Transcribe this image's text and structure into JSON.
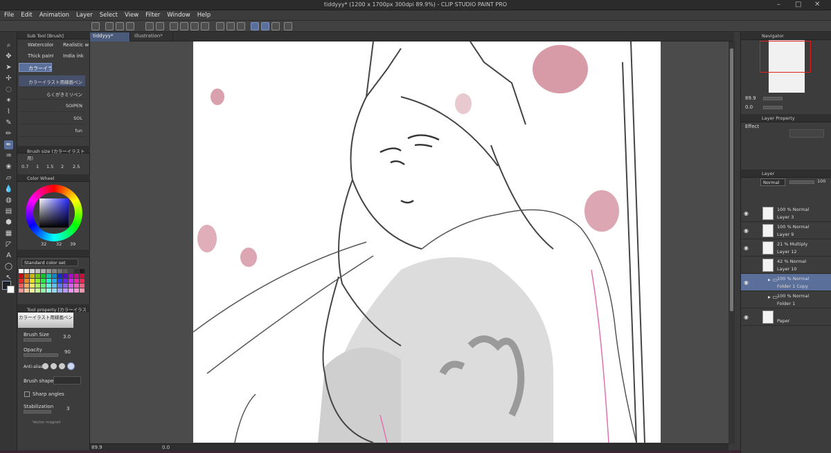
{
  "window": {
    "title": "tiddyyy* (1200 x 1700px 300dpi 89.9%) - CLIP STUDIO PAINT PRO"
  },
  "menu": [
    "File",
    "Edit",
    "Animation",
    "Layer",
    "Select",
    "View",
    "Filter",
    "Window",
    "Help"
  ],
  "tabs": [
    {
      "label": "tiddyyy*"
    },
    {
      "label": "Illustration*"
    }
  ],
  "subtool": {
    "header": "Sub Tool [Brush]",
    "groups": [
      "Watercolor",
      "Realistic w",
      "Thick paint",
      "India ink",
      "カラーイラ"
    ],
    "brushes": [
      "カラーイラスト用線画ペン",
      "らくがきミリペン",
      "SOIPEN",
      "SOL",
      "fun"
    ]
  },
  "brushsize": {
    "header": "Brush size (カラーイラスト用)",
    "values": [
      "0.7",
      "1",
      "1.5",
      "2",
      "2.5"
    ]
  },
  "colorwheel": {
    "header": "Color Wheel",
    "r": "32",
    "g": "32",
    "b": "39",
    "main_color": "#202027"
  },
  "colorset": {
    "selected": "Standard color set"
  },
  "toolprop": {
    "header": "Tool property [カラーイラスト用]",
    "name": "カラーイラスト用線画ペン",
    "brush_size_label": "Brush Size",
    "brush_size": "3.0",
    "opacity_label": "Opacity",
    "opacity": "90",
    "antialias_label": "Anti-alias",
    "brush_shape_label": "Brush shape",
    "sharp_angles": "Sharp angles",
    "stabilization_label": "Stabilization",
    "stabilization": "3",
    "vector_magnet": "Vector magnet"
  },
  "navigator": {
    "header": "Navigator",
    "zoom": "89.9",
    "rotation": "0.0"
  },
  "layerprop": {
    "header": "Layer Property",
    "effect_label": "Effect"
  },
  "layers": {
    "header": "Layer",
    "blend": "Normal",
    "opacity": "100",
    "items": [
      {
        "mode": "100 % Normal",
        "name": "Layer 3",
        "visible": true,
        "selected": false,
        "folder": false
      },
      {
        "mode": "100 % Normal",
        "name": "Layer 9",
        "visible": true,
        "selected": false,
        "folder": false
      },
      {
        "mode": "21 % Multiply",
        "name": "Layer 12",
        "visible": true,
        "selected": false,
        "folder": false
      },
      {
        "mode": "42 % Normal",
        "name": "Layer 10",
        "visible": false,
        "selected": false,
        "folder": false
      },
      {
        "mode": "100 % Normal",
        "name": "Folder 1 Copy",
        "visible": true,
        "selected": true,
        "folder": true
      },
      {
        "mode": "100 % Normal",
        "name": "Folder 1",
        "visible": false,
        "selected": false,
        "folder": true
      },
      {
        "mode": "",
        "name": "Paper",
        "visible": true,
        "selected": false,
        "folder": false
      }
    ]
  },
  "status": {
    "zoom": "89.9",
    "rotation": "0.0"
  },
  "colors": {
    "accent": "#5a6f9a",
    "petal": "#c9788a"
  }
}
